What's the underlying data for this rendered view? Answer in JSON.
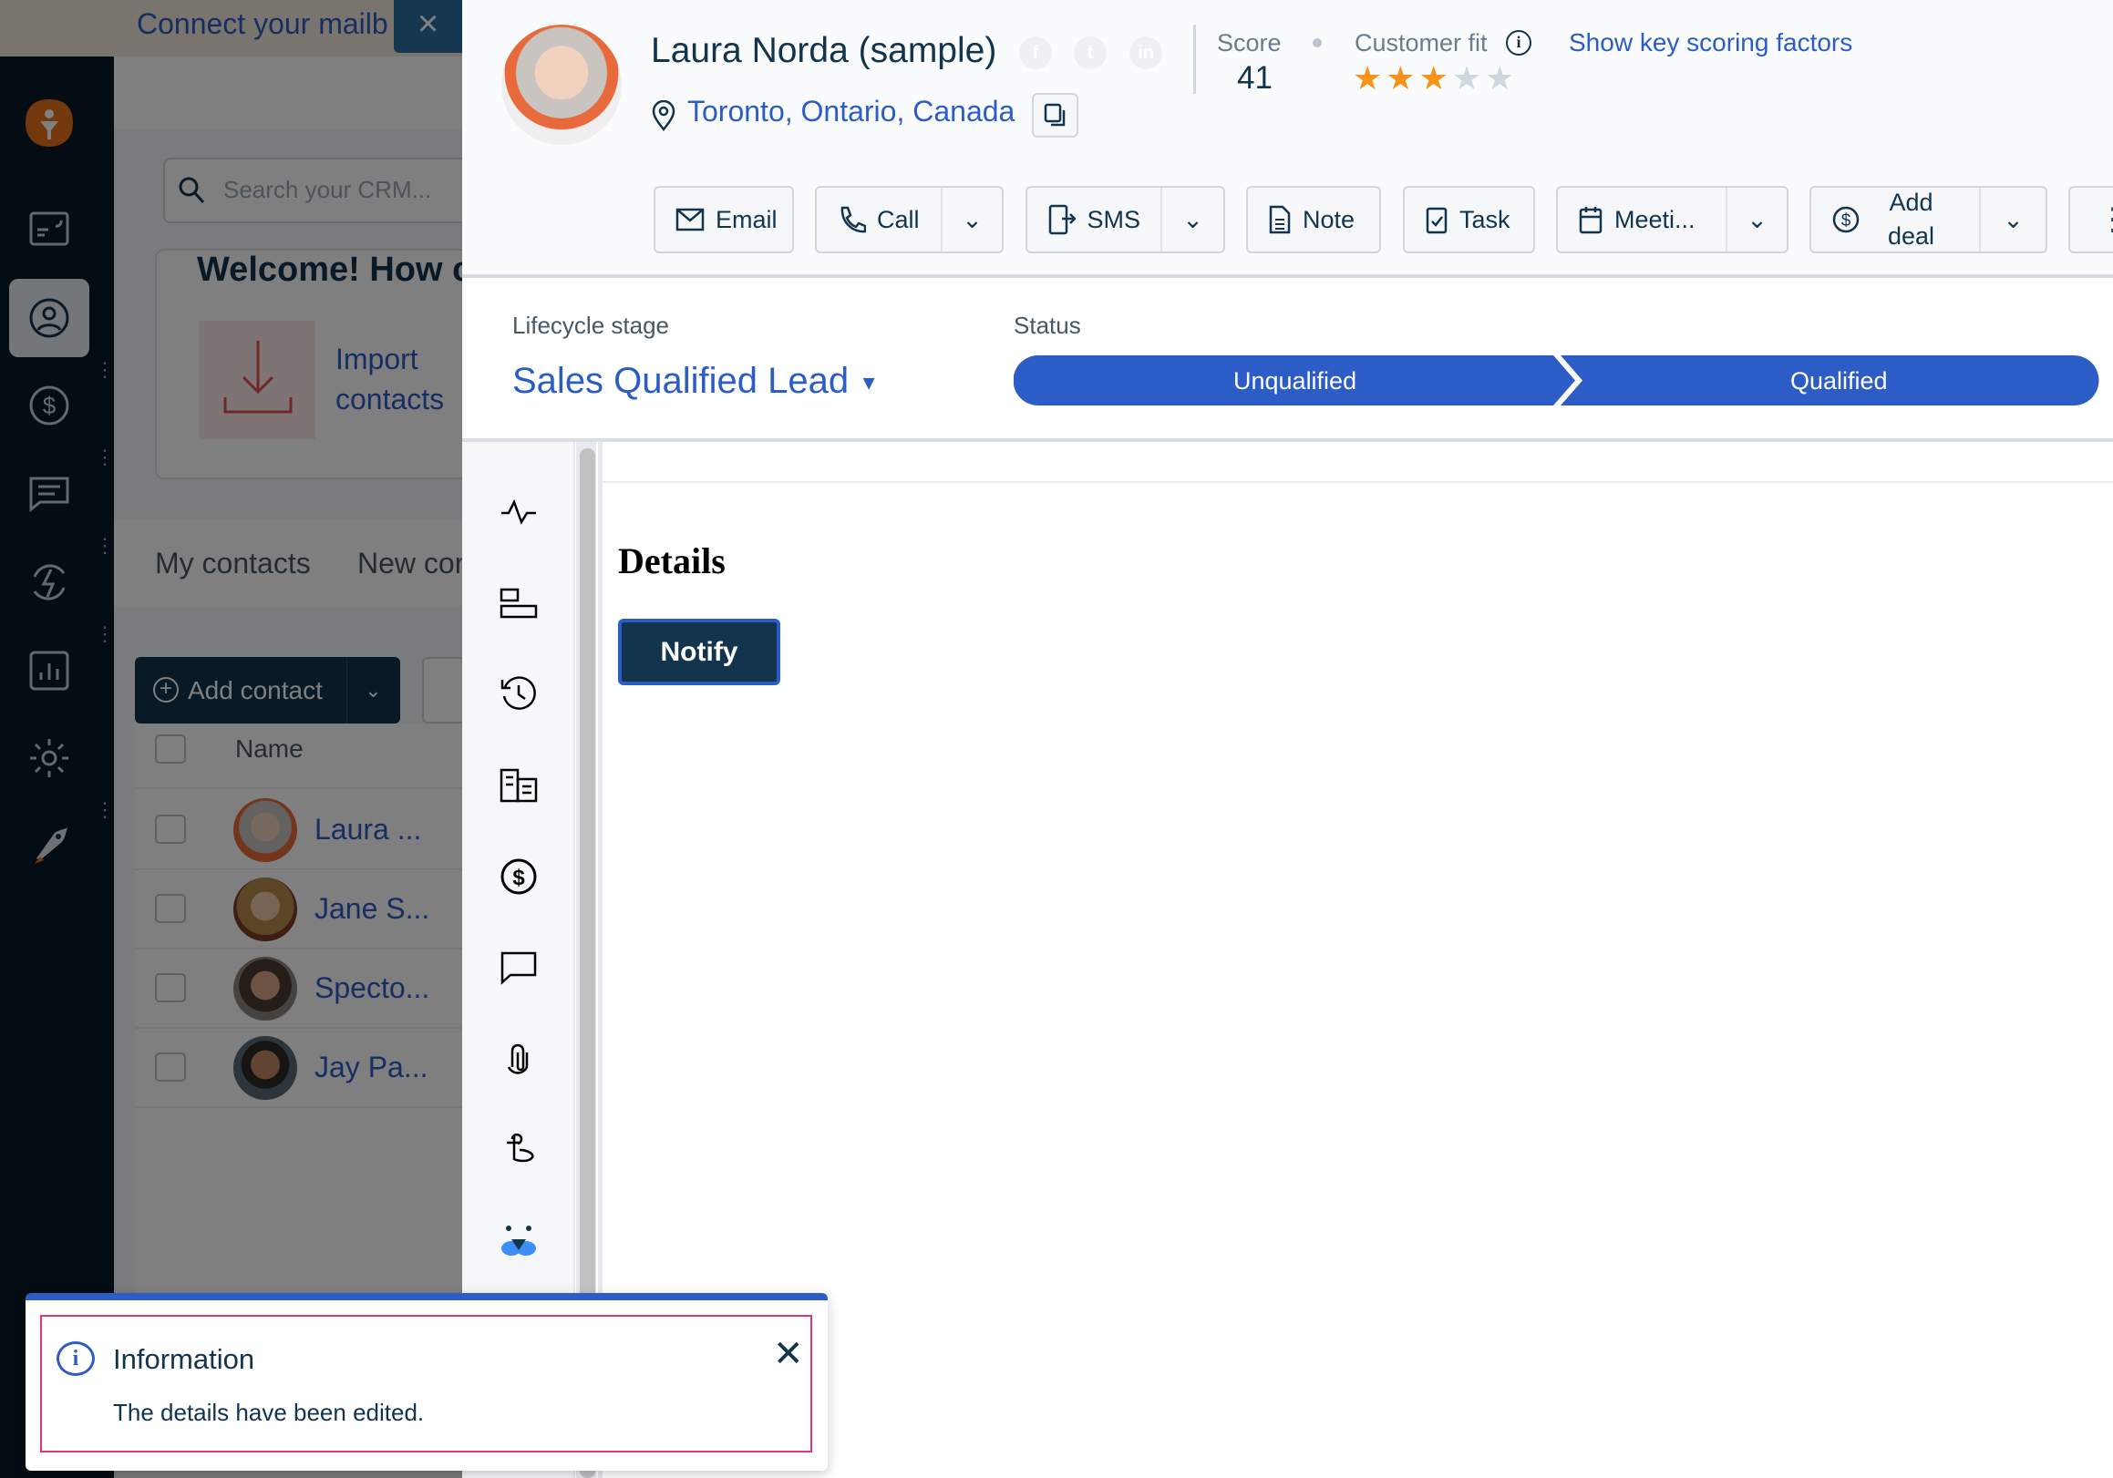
{
  "banner": {
    "text": "Connect your mailb",
    "close_icon": "close-icon"
  },
  "nav": {
    "items": [
      "dashboard",
      "contacts",
      "deals",
      "conversations",
      "automations",
      "reports",
      "settings",
      "launch"
    ],
    "active": "contacts"
  },
  "background": {
    "search_placeholder": "Search your CRM...",
    "welcome": "Welcome! How c",
    "import_line1": "Import",
    "import_line2": "contacts",
    "tabs": [
      "My contacts",
      "New con"
    ],
    "add_contact": "Add contact",
    "table_header": "Name",
    "rows": [
      {
        "name": "Laura ..."
      },
      {
        "name": "Jane S..."
      },
      {
        "name": "Specto..."
      },
      {
        "name": "Jay Pa..."
      }
    ]
  },
  "contact": {
    "name": "Laura Norda (sample)",
    "location": "Toronto, Ontario, Canada",
    "social": [
      "f",
      "t",
      "in"
    ],
    "score_label": "Score",
    "score": "41",
    "fit_label": "Customer fit",
    "fit_rating": 3,
    "fit_max": 5,
    "scoring_link": "Show key scoring factors"
  },
  "actions": {
    "email": "Email",
    "call": "Call",
    "sms": "SMS",
    "note": "Note",
    "task": "Task",
    "meeting": "Meeti...",
    "add_deal_1": "Add",
    "add_deal_2": "deal"
  },
  "lifecycle": {
    "label": "Lifecycle stage",
    "value": "Sales Qualified Lead"
  },
  "status": {
    "label": "Status",
    "stages": [
      "Unqualified",
      "Qualified"
    ]
  },
  "main": {
    "heading": "Details",
    "notify": "Notify"
  },
  "toast": {
    "title": "Information",
    "message": "The details have been edited."
  },
  "colors": {
    "accent": "#2c5cc5",
    "dark": "#12344d",
    "star_on": "#f7931a",
    "star_off": "#cfd7df",
    "toast_border": "#e4347a"
  }
}
